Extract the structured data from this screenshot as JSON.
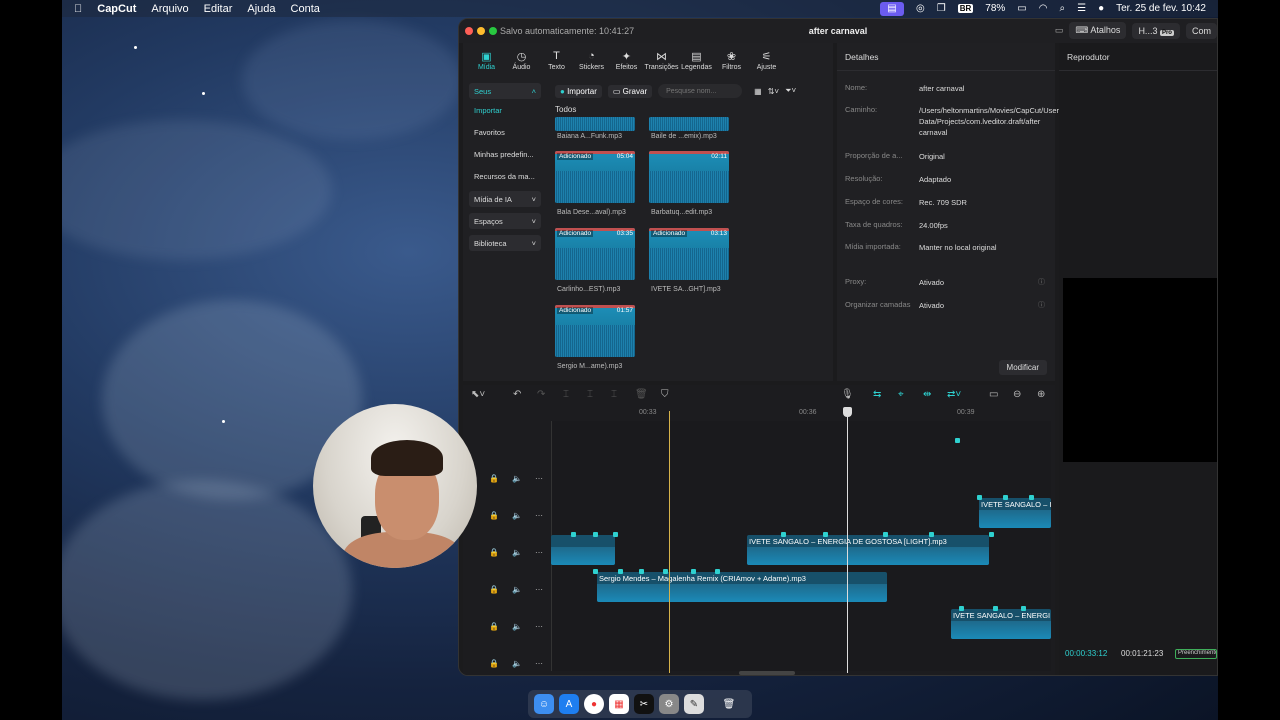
{
  "menubar": {
    "app": "CapCut",
    "items": [
      "Arquivo",
      "Editar",
      "Ajuda",
      "Conta"
    ],
    "battery": "78%",
    "keyboard": "BR",
    "datetime": "Ter. 25 de fev.  10:42"
  },
  "window": {
    "autosave": "Salvo automaticamente: 10:41:27",
    "title": "after carnaval",
    "shortcuts": "Atalhos",
    "user": "H...3",
    "pro": "Pro",
    "share": "Com"
  },
  "toolbar": {
    "tools": [
      {
        "label": "Mídia",
        "icon": "media-icon"
      },
      {
        "label": "Áudio",
        "icon": "audio-icon"
      },
      {
        "label": "Texto",
        "icon": "text-icon"
      },
      {
        "label": "Stickers",
        "icon": "sticker-icon"
      },
      {
        "label": "Efeitos",
        "icon": "effects-icon"
      },
      {
        "label": "Transições",
        "icon": "transitions-icon"
      },
      {
        "label": "Legendas",
        "icon": "captions-icon"
      },
      {
        "label": "Filtros",
        "icon": "filters-icon"
      },
      {
        "label": "Ajuste",
        "icon": "adjust-icon"
      }
    ]
  },
  "sidenav": {
    "seus": "Seus",
    "importar": "Importar",
    "favoritos": "Favoritos",
    "predefinidas": "Minhas predefin...",
    "recursos": "Recursos da ma...",
    "midia_ia": "Mídia de IA",
    "espacos": "Espaços",
    "biblioteca": "Biblioteca"
  },
  "mediabar": {
    "import": "Importar",
    "record": "Gravar",
    "search_placeholder": "Pesquise nom..."
  },
  "media": {
    "section": "Todos",
    "top_names": [
      "Baiana A...Funk.mp3",
      "Baile de ...emix).mp3"
    ],
    "clips": [
      {
        "badge": "Adicionado",
        "dur": "05:04",
        "name": "Bala Dese...aval).mp3"
      },
      {
        "badge": "",
        "dur": "02:11",
        "name": "Barbatuq...edit.mp3"
      },
      {
        "badge": "Adicionado",
        "dur": "03:35",
        "name": "Carlinho...EST).mp3"
      },
      {
        "badge": "Adicionado",
        "dur": "03:13",
        "name": "IVETE SA...GHT].mp3"
      },
      {
        "badge": "Adicionado",
        "dur": "01:57",
        "name": "Sergio M...ame).mp3"
      }
    ]
  },
  "details": {
    "header": "Detalhes",
    "rows": [
      {
        "k": "Nome:",
        "v": "after carnaval"
      },
      {
        "k": "Caminho:",
        "v": "/Users/heltonmartins/Movies/CapCut/User Data/Projects/com.lveditor.draft/after carnaval"
      },
      {
        "k": "Proporção de a...",
        "v": "Original"
      },
      {
        "k": "Resolução:",
        "v": "Adaptado"
      },
      {
        "k": "Espaço de cores:",
        "v": "Rec. 709 SDR"
      },
      {
        "k": "Taxa de quadros:",
        "v": "24.00fps"
      },
      {
        "k": "Mídia importada:",
        "v": "Manter no local original"
      },
      {
        "k": "Proxy:",
        "v": "Ativado"
      },
      {
        "k": "Organizar camadas",
        "v": "Ativado"
      }
    ],
    "modify": "Modificar"
  },
  "player": {
    "header": "Reprodutor",
    "current": "00:00:33:12",
    "total": "00:01:21:23",
    "preview_label": "Preenchimento"
  },
  "timeline": {
    "ticks": [
      "00:33",
      "00:36",
      "00:39"
    ],
    "clips": [
      {
        "label": "IVETE SANGALO – ENERGIA DE GOSTOSA [LIGHT].mp3"
      },
      {
        "label": "Sergio Mendes – Magalenha Remix (CRIAmov + Adame).mp3"
      },
      {
        "label": "IVETE SANGALO – I"
      },
      {
        "label": "IVETE SANGALO – ENERGI"
      }
    ]
  }
}
